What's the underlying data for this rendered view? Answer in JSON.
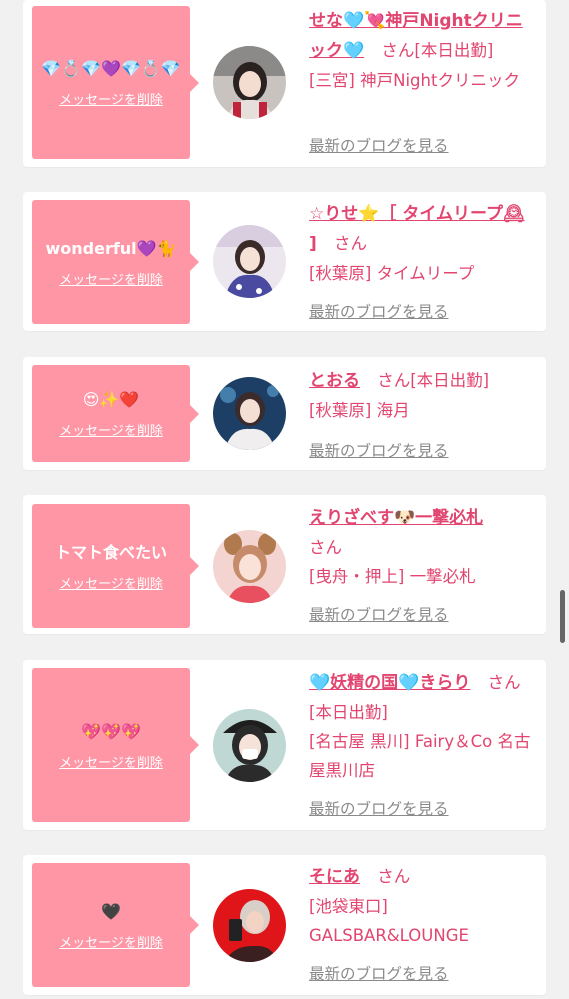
{
  "common": {
    "delete_label": "メッセージを削除",
    "san": "さん",
    "blog_label": "最新のブログを見る"
  },
  "cards": [
    {
      "message": "💎💍💎💜💎💍💎",
      "name": "せな🩵💘神戸Nightクリニック🩵",
      "status": "[本日出勤]",
      "shop": "[三宮] 神戸Nightクリニック",
      "avatar_icon": "girl-in-red-top-photo"
    },
    {
      "message": "wonderful💜🐈",
      "name": "☆りせ⭐️［ タイムリープ🕰 ]",
      "status": "",
      "shop": "[秋葉原] タイムリープ",
      "avatar_icon": "girl-in-kimono-photo"
    },
    {
      "message": "😍✨❤️",
      "name": "とおる",
      "status": "[本日出勤]",
      "shop": "[秋葉原] 海月",
      "avatar_icon": "girl-in-aquarium-photo"
    },
    {
      "message": "トマト食べたい",
      "name": "えりざべす🐶一撃必札",
      "status": "",
      "shop": "[曳舟・押上] 一撃必札",
      "avatar_icon": "girl-with-dog-ears-photo"
    },
    {
      "message": "💖💖💖",
      "name": "🩵妖精の国🩵きらり",
      "status": "[本日出勤]",
      "shop": "[名古屋 黒川] Fairy＆Co 名古屋黒川店",
      "avatar_icon": "masked-girl-with-headdress-photo"
    },
    {
      "message": "🖤",
      "name": "そにあ",
      "status": "",
      "shop": "[池袋東口] GALSBAR&LOUNGE",
      "avatar_icon": "girl-taking-selfie-photo"
    }
  ]
}
